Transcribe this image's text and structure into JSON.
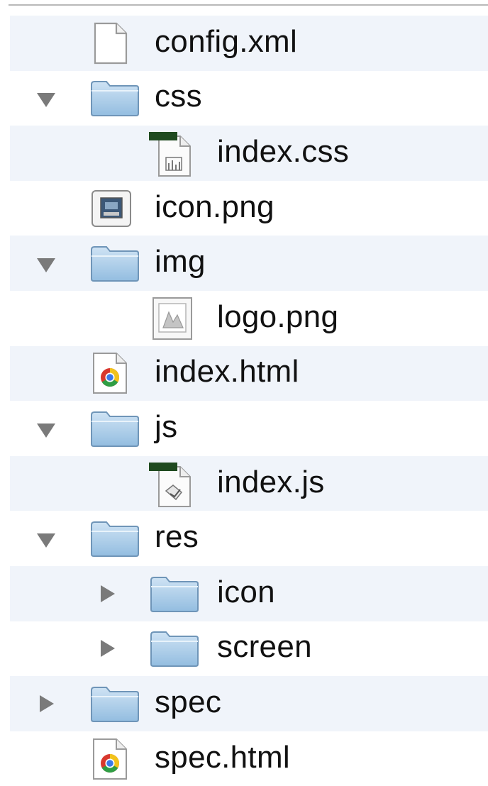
{
  "tree": {
    "rows": [
      {
        "label": "config.xml",
        "icon": "document-icon",
        "depth": 0,
        "disclosure": "none"
      },
      {
        "label": "css",
        "icon": "folder-icon",
        "depth": 0,
        "disclosure": "expanded"
      },
      {
        "label": "index.css",
        "icon": "stylesheet-file-icon",
        "depth": 1,
        "disclosure": "none"
      },
      {
        "label": "icon.png",
        "icon": "image-file-icon",
        "depth": 0,
        "disclosure": "none"
      },
      {
        "label": "img",
        "icon": "folder-icon",
        "depth": 0,
        "disclosure": "expanded"
      },
      {
        "label": "logo.png",
        "icon": "image-preview-icon",
        "depth": 1,
        "disclosure": "none"
      },
      {
        "label": "index.html",
        "icon": "chrome-html-file-icon",
        "depth": 0,
        "disclosure": "none"
      },
      {
        "label": "js",
        "icon": "folder-icon",
        "depth": 0,
        "disclosure": "expanded"
      },
      {
        "label": "index.js",
        "icon": "script-file-icon",
        "depth": 1,
        "disclosure": "none"
      },
      {
        "label": "res",
        "icon": "folder-icon",
        "depth": 0,
        "disclosure": "expanded"
      },
      {
        "label": "icon",
        "icon": "folder-icon",
        "depth": 1,
        "disclosure": "collapsed"
      },
      {
        "label": "screen",
        "icon": "folder-icon",
        "depth": 1,
        "disclosure": "collapsed"
      },
      {
        "label": "spec",
        "icon": "folder-icon",
        "depth": 0,
        "disclosure": "collapsed"
      },
      {
        "label": "spec.html",
        "icon": "chrome-html-file-icon",
        "depth": 0,
        "disclosure": "none"
      }
    ]
  },
  "colors": {
    "stripe": "#f0f4fa",
    "folder": "#a9cbe8",
    "disclosure": "#7a7a7a",
    "text": "#111111"
  }
}
